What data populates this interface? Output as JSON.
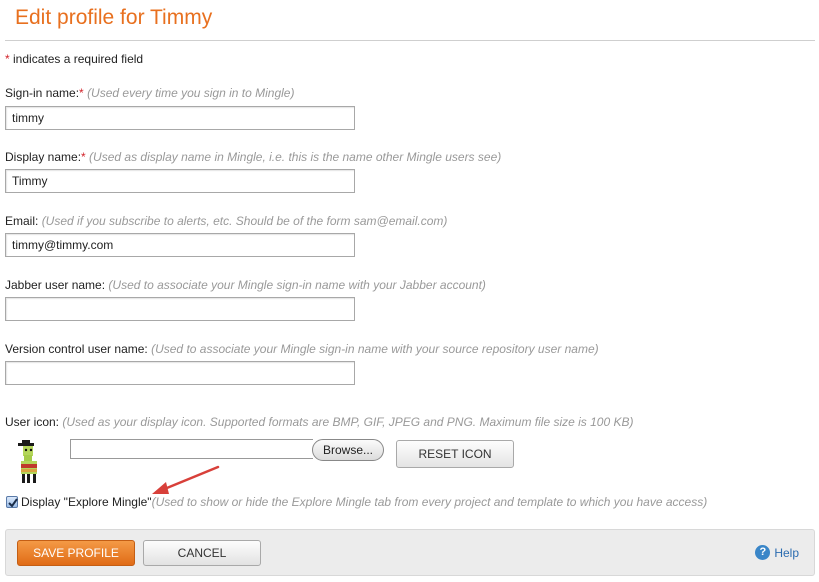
{
  "page": {
    "title": "Edit profile for Timmy",
    "required_note": "indicates a required field",
    "required_marker": "*"
  },
  "fields": {
    "signin": {
      "label": "Sign-in name:",
      "required": "*",
      "hint": "(Used every time you sign in to Mingle)",
      "value": "timmy"
    },
    "display": {
      "label": "Display name:",
      "required": "*",
      "hint": "(Used as display name in Mingle, i.e. this is the name other Mingle users see)",
      "value": "Timmy"
    },
    "email": {
      "label": "Email:",
      "hint": "(Used if you subscribe to alerts, etc. Should be of the form sam@email.com)",
      "value": "timmy@timmy.com"
    },
    "jabber": {
      "label": "Jabber user name:",
      "hint": "(Used to associate your Mingle sign-in name with your Jabber account)",
      "value": ""
    },
    "vcs": {
      "label": "Version control user name:",
      "hint": "(Used to associate your Mingle sign-in name with your source repository user name)",
      "value": ""
    }
  },
  "user_icon": {
    "label": "User icon:",
    "hint": "(Used as your display icon. Supported formats are BMP, GIF, JPEG and PNG. Maximum file size is 100 KB)",
    "browse_label": "Browse...",
    "reset_label": "RESET ICON",
    "avatar_icon": "llama-avatar-icon"
  },
  "explore": {
    "checked": true,
    "label": "Display \"Explore Mingle\"",
    "hint": "(Used to show or hide the Explore Mingle tab from every project and template to which you have access)"
  },
  "footer": {
    "save_label": "SAVE PROFILE",
    "cancel_label": "CANCEL",
    "help_label": "Help",
    "help_icon": "?"
  },
  "colors": {
    "accent": "#e8701f",
    "required": "#d2232a",
    "hint": "#999999",
    "annotation_arrow": "#d8403a",
    "help_link": "#2b6cb0"
  }
}
